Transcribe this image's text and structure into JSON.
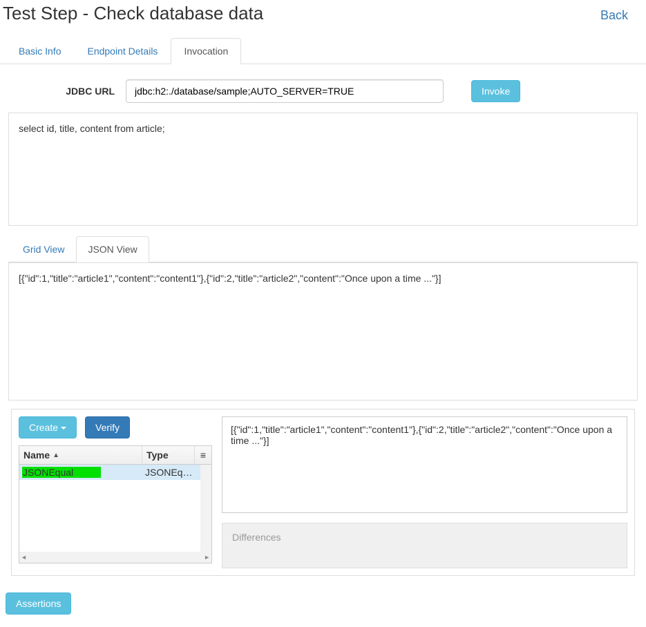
{
  "header": {
    "title": "Test Step - Check database data",
    "back": "Back"
  },
  "topTabs": {
    "basicInfo": "Basic Info",
    "endpointDetails": "Endpoint Details",
    "invocation": "Invocation"
  },
  "form": {
    "jdbcLabel": "JDBC URL",
    "jdbcValue": "jdbc:h2:./database/sample;AUTO_SERVER=TRUE",
    "invoke": "Invoke"
  },
  "sql": "select id, title, content from article;",
  "viewTabs": {
    "grid": "Grid View",
    "json": "JSON View"
  },
  "jsonResult": "[{\"id\":1,\"title\":\"article1\",\"content\":\"content1\"},{\"id\":2,\"title\":\"article2\",\"content\":\"Once upon a time ...\"}]",
  "controls": {
    "create": "Create",
    "verify": "Verify"
  },
  "grid": {
    "colName": "Name",
    "colType": "Type",
    "rows": [
      {
        "name": "JSONEqual",
        "type": "JSONEq…"
      }
    ]
  },
  "expected": "[{\"id\":1,\"title\":\"article1\",\"content\":\"content1\"},{\"id\":2,\"title\":\"article2\",\"content\":\"Once upon a time ...\"}]",
  "differences": "Differences",
  "footer": {
    "assertions": "Assertions"
  }
}
